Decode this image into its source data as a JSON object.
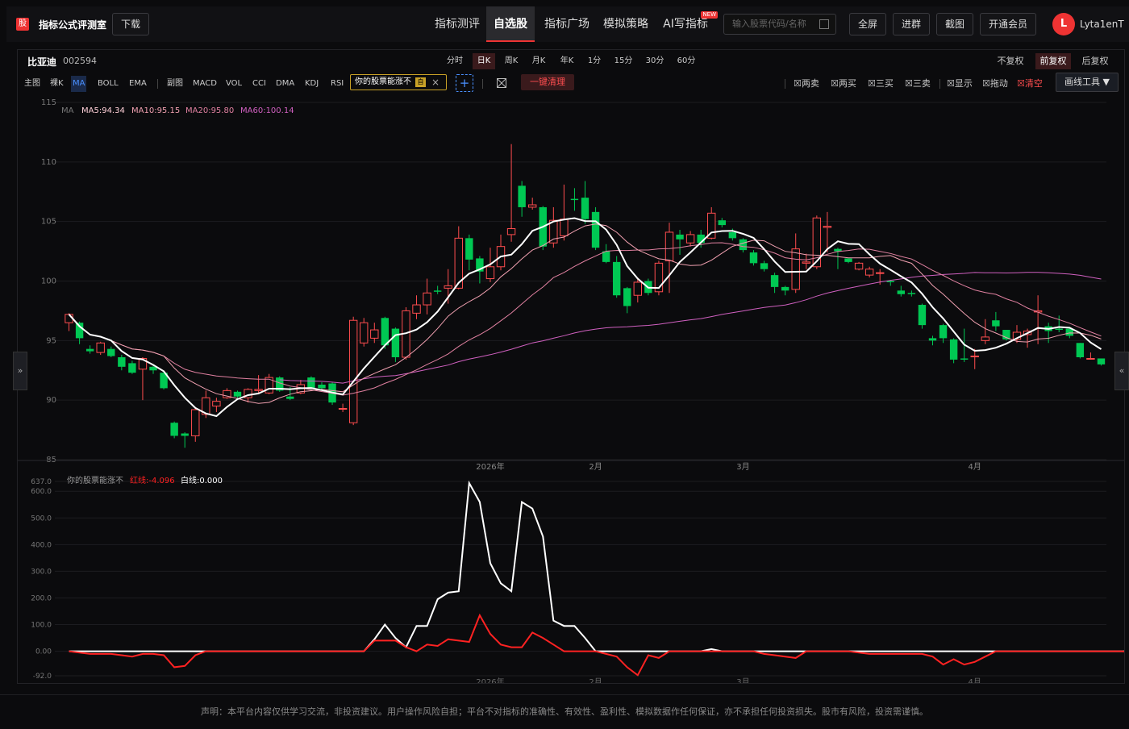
{
  "header": {
    "logo_char": "股",
    "brand": "指标公式评测室",
    "download_label": "下载",
    "nav": [
      {
        "label": "指标测评",
        "active": false
      },
      {
        "label": "自选股",
        "active": true
      },
      {
        "label": "指标广场",
        "active": false
      },
      {
        "label": "模拟策略",
        "active": false
      },
      {
        "label": "AI写指标",
        "active": false,
        "badge": "NEW"
      }
    ],
    "search_placeholder": "输入股票代码/名称",
    "buttons": [
      "全屏",
      "进群",
      "截图",
      "开通会员"
    ],
    "avatar_letter": "L",
    "username": "Lyta1enT"
  },
  "stock": {
    "name": "比亚迪",
    "code": "002594"
  },
  "periods": [
    {
      "label": "分时",
      "active": false
    },
    {
      "label": "日K",
      "active": true
    },
    {
      "label": "周K",
      "active": false
    },
    {
      "label": "月K",
      "active": false
    },
    {
      "label": "年K",
      "active": false
    },
    {
      "label": "1分",
      "active": false
    },
    {
      "label": "15分",
      "active": false
    },
    {
      "label": "30分",
      "active": false
    },
    {
      "label": "60分",
      "active": false
    }
  ],
  "adjust": [
    {
      "label": "不复权",
      "active": false
    },
    {
      "label": "前复权",
      "active": true
    },
    {
      "label": "后复权",
      "active": false
    }
  ],
  "main_indicators": {
    "label": "主图",
    "items": [
      {
        "label": "裸K",
        "active": false
      },
      {
        "label": "MA",
        "active": true
      },
      {
        "label": "BOLL",
        "active": false
      },
      {
        "label": "EMA",
        "active": false
      }
    ]
  },
  "sub_indicators": {
    "label": "副图",
    "items": [
      "MACD",
      "VOL",
      "CCI",
      "DMA",
      "KDJ",
      "RSI"
    ]
  },
  "formula_tag": {
    "label": "你的股票能涨不",
    "edit": "自"
  },
  "clear_label": "一键清理",
  "checks": [
    {
      "label": "两卖",
      "red": false
    },
    {
      "label": "两买",
      "red": false
    },
    {
      "label": "三买",
      "red": false
    },
    {
      "label": "三卖",
      "red": false
    },
    {
      "label": "显示",
      "red": false
    },
    {
      "label": "拖动",
      "red": false
    },
    {
      "label": "清空",
      "red": true
    }
  ],
  "draw_tool_label": "画线工具 ▼",
  "colors": {
    "up": "#ff4d4f",
    "down": "#00c853",
    "ma5": "#ffffff",
    "ma10": "#f0a0b0",
    "ma20": "#e080a0",
    "ma60": "#d060c0"
  },
  "chart_data": [
    {
      "type": "candlestick",
      "ma_legend": {
        "prefix": "MA",
        "items": [
          "MA5:94.34",
          "MA10:95.15",
          "MA20:95.80",
          "MA60:100.14"
        ]
      },
      "y_ticks": [
        "115",
        "110",
        "105",
        "100",
        "95",
        "90",
        "85"
      ],
      "ylim": [
        85,
        115
      ],
      "x_labels": [
        {
          "index": 40,
          "label": "2026年"
        },
        {
          "index": 50,
          "label": "2月"
        },
        {
          "index": 64,
          "label": "3月"
        },
        {
          "index": 86,
          "label": "4月"
        }
      ],
      "candles": [
        [
          96.5,
          97.2,
          95.8,
          97.3
        ],
        [
          96.5,
          95.2,
          94.7,
          96.6
        ],
        [
          94.3,
          94.1,
          93.9,
          94.6
        ],
        [
          94.0,
          94.8,
          93.8,
          94.9
        ],
        [
          94.3,
          93.7,
          93.6,
          94.5
        ],
        [
          93.6,
          92.8,
          92.5,
          93.8
        ],
        [
          93.1,
          92.3,
          92.2,
          93.3
        ],
        [
          92.6,
          93.5,
          90.0,
          93.6
        ],
        [
          92.8,
          92.5,
          92.2,
          93.0
        ],
        [
          92.3,
          91.0,
          90.9,
          92.4
        ],
        [
          88.1,
          87.0,
          86.8,
          88.2
        ],
        [
          87.2,
          87.0,
          86.0,
          87.3
        ],
        [
          87.0,
          89.2,
          86.5,
          89.3
        ],
        [
          88.8,
          90.2,
          88.5,
          90.8
        ],
        [
          89.5,
          89.9,
          89.0,
          90.2
        ],
        [
          90.2,
          90.8,
          90.1,
          91.0
        ],
        [
          90.7,
          90.3,
          90.2,
          90.8
        ],
        [
          90.2,
          90.9,
          89.8,
          91.0
        ],
        [
          90.8,
          90.9,
          90.5,
          92.1
        ],
        [
          90.6,
          91.9,
          90.5,
          92.2
        ],
        [
          91.9,
          90.8,
          90.7,
          92.0
        ],
        [
          90.3,
          90.1,
          90.0,
          91.1
        ],
        [
          90.6,
          91.3,
          90.5,
          91.7
        ],
        [
          91.9,
          91.0,
          90.8,
          92.0
        ],
        [
          91.3,
          91.0,
          90.8,
          91.5
        ],
        [
          91.4,
          89.8,
          89.6,
          91.5
        ],
        [
          89.3,
          89.3,
          89.0,
          89.7
        ],
        [
          88.1,
          96.7,
          87.9,
          97.0
        ],
        [
          94.8,
          96.5,
          94.5,
          96.9
        ],
        [
          95.2,
          95.9,
          94.8,
          96.5
        ],
        [
          96.9,
          94.6,
          94.3,
          97.0
        ],
        [
          96.0,
          93.6,
          93.2,
          96.1
        ],
        [
          93.6,
          97.5,
          93.4,
          97.8
        ],
        [
          97.3,
          98.0,
          96.8,
          98.8
        ],
        [
          98.0,
          99.0,
          97.2,
          100.2
        ],
        [
          99.2,
          99.1,
          98.9,
          99.6
        ],
        [
          99.4,
          99.6,
          98.1,
          101.0
        ],
        [
          99.4,
          103.6,
          99.3,
          104.6
        ],
        [
          103.6,
          101.8,
          100.9,
          103.9
        ],
        [
          101.9,
          100.8,
          99.8,
          102.1
        ],
        [
          100.2,
          101.2,
          99.9,
          102.8
        ],
        [
          101.2,
          102.9,
          100.9,
          103.9
        ],
        [
          103.9,
          104.4,
          103.3,
          111.5
        ],
        [
          108.0,
          106.2,
          105.4,
          108.4
        ],
        [
          106.2,
          106.4,
          106.0,
          107.0
        ],
        [
          106.2,
          102.9,
          102.6,
          106.3
        ],
        [
          103.2,
          105.1,
          102.8,
          106.2
        ],
        [
          103.8,
          105.2,
          103.4,
          108.1
        ],
        [
          106.9,
          106.8,
          105.9,
          107.8
        ],
        [
          107.0,
          105.2,
          104.8,
          108.4
        ],
        [
          105.8,
          102.8,
          102.6,
          106.2
        ],
        [
          102.5,
          101.6,
          101.5,
          103.1
        ],
        [
          101.6,
          98.8,
          98.6,
          102.1
        ],
        [
          99.4,
          97.9,
          97.3,
          99.5
        ],
        [
          98.8,
          99.9,
          98.2,
          100.3
        ],
        [
          100.0,
          99.0,
          98.8,
          100.2
        ],
        [
          99.1,
          101.5,
          98.8,
          101.7
        ],
        [
          101.7,
          104.1,
          99.0,
          104.9
        ],
        [
          103.9,
          103.5,
          102.2,
          104.3
        ],
        [
          103.2,
          103.9,
          102.9,
          104.2
        ],
        [
          103.9,
          103.2,
          102.8,
          104.3
        ],
        [
          103.6,
          105.7,
          103.5,
          106.2
        ],
        [
          105.1,
          104.7,
          104.5,
          105.3
        ],
        [
          104.1,
          103.6,
          103.4,
          104.4
        ],
        [
          103.5,
          102.6,
          102.4,
          103.6
        ],
        [
          102.4,
          101.5,
          101.3,
          102.6
        ],
        [
          101.5,
          101.0,
          100.8,
          101.7
        ],
        [
          100.5,
          99.5,
          99.0,
          100.7
        ],
        [
          99.5,
          99.2,
          98.8,
          99.6
        ],
        [
          99.3,
          102.7,
          99.0,
          104.0
        ],
        [
          101.5,
          101.6,
          101.0,
          102.3
        ],
        [
          101.2,
          105.3,
          101.0,
          105.5
        ],
        [
          104.5,
          104.6,
          102.4,
          105.8
        ],
        [
          102.7,
          102.5,
          101.0,
          102.8
        ],
        [
          101.9,
          101.6,
          101.5,
          101.9
        ],
        [
          101.0,
          101.5,
          100.9,
          101.6
        ],
        [
          100.5,
          101.0,
          100.3,
          101.2
        ],
        [
          100.7,
          100.7,
          99.7,
          101.0
        ],
        [
          100.0,
          99.9,
          99.6,
          100.1
        ],
        [
          99.2,
          98.9,
          98.7,
          99.6
        ],
        [
          99.0,
          98.9,
          98.7,
          99.2
        ],
        [
          98.0,
          96.3,
          96.0,
          98.1
        ],
        [
          95.2,
          95.0,
          94.6,
          95.4
        ],
        [
          96.3,
          95.2,
          94.8,
          96.4
        ],
        [
          95.1,
          93.4,
          93.1,
          95.2
        ],
        [
          93.5,
          93.4,
          93.2,
          96.0
        ],
        [
          93.7,
          93.7,
          92.6,
          94.3
        ],
        [
          95.0,
          95.3,
          94.7,
          96.8
        ],
        [
          96.7,
          96.2,
          95.8,
          97.4
        ],
        [
          95.9,
          95.1,
          95.0,
          95.9
        ],
        [
          95.1,
          95.7,
          94.8,
          96.3
        ],
        [
          95.5,
          95.8,
          94.4,
          96.0
        ],
        [
          97.4,
          97.5,
          94.7,
          98.8
        ],
        [
          96.2,
          95.8,
          94.8,
          96.5
        ],
        [
          96.0,
          95.9,
          95.7,
          97.1
        ],
        [
          96.0,
          95.4,
          95.2,
          96.0
        ],
        [
          94.8,
          93.6,
          93.5,
          94.8
        ],
        [
          93.5,
          93.5,
          93.4,
          94.0
        ],
        [
          93.5,
          93.0,
          92.9,
          93.5
        ]
      ]
    },
    {
      "type": "line",
      "legend_name": "你的股票能涨不",
      "red_label": "红线:-4.096",
      "white_label": "白线:0.000",
      "y_ticks": [
        "637.0",
        "600.0",
        "500.0",
        "400.0",
        "300.0",
        "200.0",
        "100.0",
        "0.00",
        "-92.0"
      ],
      "ylim": [
        -92,
        637
      ],
      "series": [
        {
          "color": "#ffffff",
          "values": [
            0,
            0,
            0,
            0,
            0,
            0,
            0,
            0,
            0,
            0,
            0,
            0,
            0,
            0,
            0,
            0,
            0,
            0,
            0,
            0,
            0,
            0,
            0,
            0,
            0,
            0,
            0,
            0,
            0,
            45,
            100,
            50,
            15,
            95,
            95,
            195,
            220,
            225,
            631,
            560,
            330,
            255,
            225,
            560,
            535,
            430,
            115,
            95,
            95,
            50,
            0,
            0,
            0,
            0,
            0,
            0,
            0,
            0,
            0,
            0,
            0,
            8,
            0,
            0,
            0,
            0,
            0,
            0,
            0,
            0,
            0,
            0,
            0,
            0,
            0,
            0,
            0,
            0,
            0,
            0,
            0,
            0,
            0,
            0,
            0,
            0,
            0,
            0,
            0,
            0,
            0,
            0,
            0,
            0,
            0,
            0,
            0,
            0,
            0,
            0,
            0,
            0,
            0
          ]
        },
        {
          "color": "#ff2222",
          "values": [
            0,
            -5,
            -10,
            -10,
            -10,
            -15,
            -20,
            -10,
            -10,
            -15,
            -60,
            -55,
            -15,
            0,
            0,
            0,
            0,
            0,
            0,
            0,
            0,
            0,
            0,
            0,
            0,
            0,
            0,
            0,
            0,
            40,
            40,
            40,
            15,
            0,
            25,
            20,
            45,
            40,
            35,
            135,
            65,
            25,
            15,
            15,
            70,
            50,
            25,
            0,
            0,
            0,
            0,
            -10,
            -20,
            -60,
            -90,
            -15,
            -25,
            0,
            0,
            0,
            0,
            0,
            0,
            0,
            0,
            0,
            -10,
            -15,
            -20,
            -25,
            0,
            0,
            0,
            0,
            0,
            -5,
            -10,
            -10,
            -10,
            -10,
            -10,
            -10,
            -20,
            -50,
            -30,
            -50,
            -40,
            -20,
            0,
            0,
            0,
            0,
            0,
            0,
            0,
            0,
            0,
            0,
            0,
            0,
            0,
            -5,
            -5
          ]
        }
      ]
    }
  ],
  "side": {
    "left": "»",
    "right": "«"
  },
  "disclaimer": "声明：本平台内容仅供学习交流，非投资建议。用户操作风险自担；平台不对指标的准确性、有效性、盈利性、模拟数据作任何保证，亦不承担任何投资损失。股市有风险，投资需谨慎。"
}
